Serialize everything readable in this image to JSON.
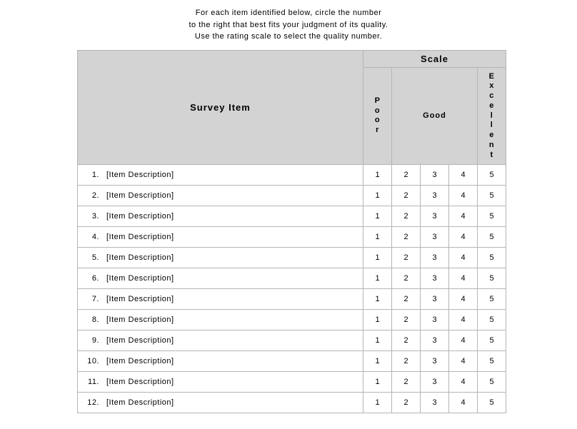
{
  "instructions": {
    "line1": "For each item identified below, circle the number",
    "line2": "to the right that best fits your judgment of its quality.",
    "line3": "Use the rating scale to select the quality number."
  },
  "headers": {
    "surveyItem": "Survey Item",
    "scale": "Scale",
    "poor": "Poor",
    "good": "Good",
    "excellent": "Excellent"
  },
  "ratingValues": [
    "1",
    "2",
    "3",
    "4",
    "5"
  ],
  "items": [
    {
      "n": "1.",
      "desc": "[Item Description]"
    },
    {
      "n": "2.",
      "desc": "[Item Description]"
    },
    {
      "n": "3.",
      "desc": "[Item Description]"
    },
    {
      "n": "4.",
      "desc": "[Item Description]"
    },
    {
      "n": "5.",
      "desc": "[Item Description]"
    },
    {
      "n": "6.",
      "desc": "[Item Description]"
    },
    {
      "n": "7.",
      "desc": "[Item Description]"
    },
    {
      "n": "8.",
      "desc": "[Item Description]"
    },
    {
      "n": "9.",
      "desc": "[Item Description]"
    },
    {
      "n": "10.",
      "desc": "[Item Description]"
    },
    {
      "n": "11.",
      "desc": "[Item Description]"
    },
    {
      "n": "12.",
      "desc": "[Item Description]"
    }
  ]
}
